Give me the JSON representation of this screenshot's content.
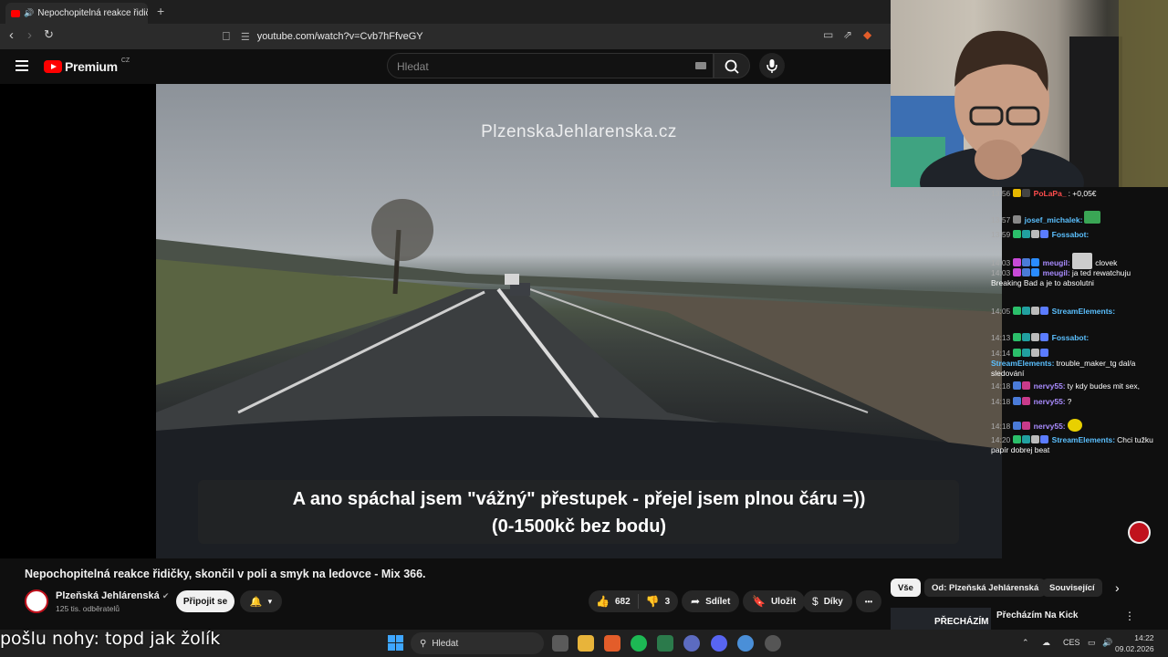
{
  "browser": {
    "tab_title": "Nepochopitelná reakce řidičk",
    "new_tab": "+",
    "url": "youtube.com/watch?v=Cvb7hFfveGY"
  },
  "youtube": {
    "logo_text": "Premium",
    "logo_region": "CZ",
    "search_placeholder": "Hledat"
  },
  "video": {
    "watermark": "PlzenskaJehlarenska.cz",
    "subtitle_line1": "A ano spáchal jsem \"vážný\" přestupek  - přejel jsem plnou čáru =))",
    "subtitle_line2": "(0-1500kč bez bodu)",
    "title": "Nepochopitelná reakce řidičky, skončil v poli a smyk na ledovce - Mix 366."
  },
  "channel": {
    "name": "Plzeňská Jehlárenská",
    "subscribers": "125 tis. odběratelů",
    "join_label": "Připojit se"
  },
  "actions": {
    "likes": "682",
    "dislikes": "3",
    "share": "Sdílet",
    "save": "Uložit",
    "thanks": "Díky",
    "more": "•••"
  },
  "sidebar": {
    "chips": [
      "Vše",
      "Od: Plzeňská Jehlárenská",
      "Související"
    ],
    "related_title": "Přecházím Na Kick",
    "related_thumb_text": "PŘECHÁZÍM"
  },
  "chat": [
    {
      "time": "13:56",
      "user": "PoLaPa_",
      "text": ": +0,05€",
      "color": "#ff4d4d"
    },
    {
      "time": "13:57",
      "user": "josef_michalek:",
      "text": "",
      "color": "#5bc0ff"
    },
    {
      "time": "13:59",
      "user": "Fossabot:",
      "text": "",
      "color": "#5bc0ff"
    },
    {
      "time": "14:03",
      "user": "meugil:",
      "text": "clovek",
      "color": "#a98bff"
    },
    {
      "time": "14:03",
      "user": "meugil:",
      "text": "ja ted rewatchuju Breaking Bad a je to absolutni",
      "color": "#a98bff"
    },
    {
      "time": "14:05",
      "user": "StreamElements:",
      "text": "",
      "color": "#5bc0ff"
    },
    {
      "time": "14:13",
      "user": "Fossabot:",
      "text": "",
      "color": "#5bc0ff"
    },
    {
      "time": "14:14",
      "user": "StreamElements:",
      "text": "trouble_maker_tg dal/a sledování",
      "color": "#5bc0ff"
    },
    {
      "time": "14:18",
      "user": "nervy55:",
      "text": "ty kdy budes mit sex,",
      "color": "#a98bff"
    },
    {
      "time": "14:18",
      "user": "nervy55:",
      "text": "?",
      "color": "#a98bff"
    },
    {
      "time": "14:18",
      "user": "nervy55:",
      "text": "",
      "color": "#a98bff"
    },
    {
      "time": "14:20",
      "user": "StreamElements:",
      "text": "Chci tužku papír dobrej beat",
      "color": "#5bc0ff"
    }
  ],
  "overlay_ticker": "pošlu nohy: topd jak žolík",
  "taskbar": {
    "search": "Hledat",
    "lang": "CES",
    "time": "14:22",
    "date": "09.02.2026"
  },
  "colors": {
    "youtube_red": "#ff0000",
    "background": "#0f0f0f",
    "button_dark": "#272727"
  }
}
